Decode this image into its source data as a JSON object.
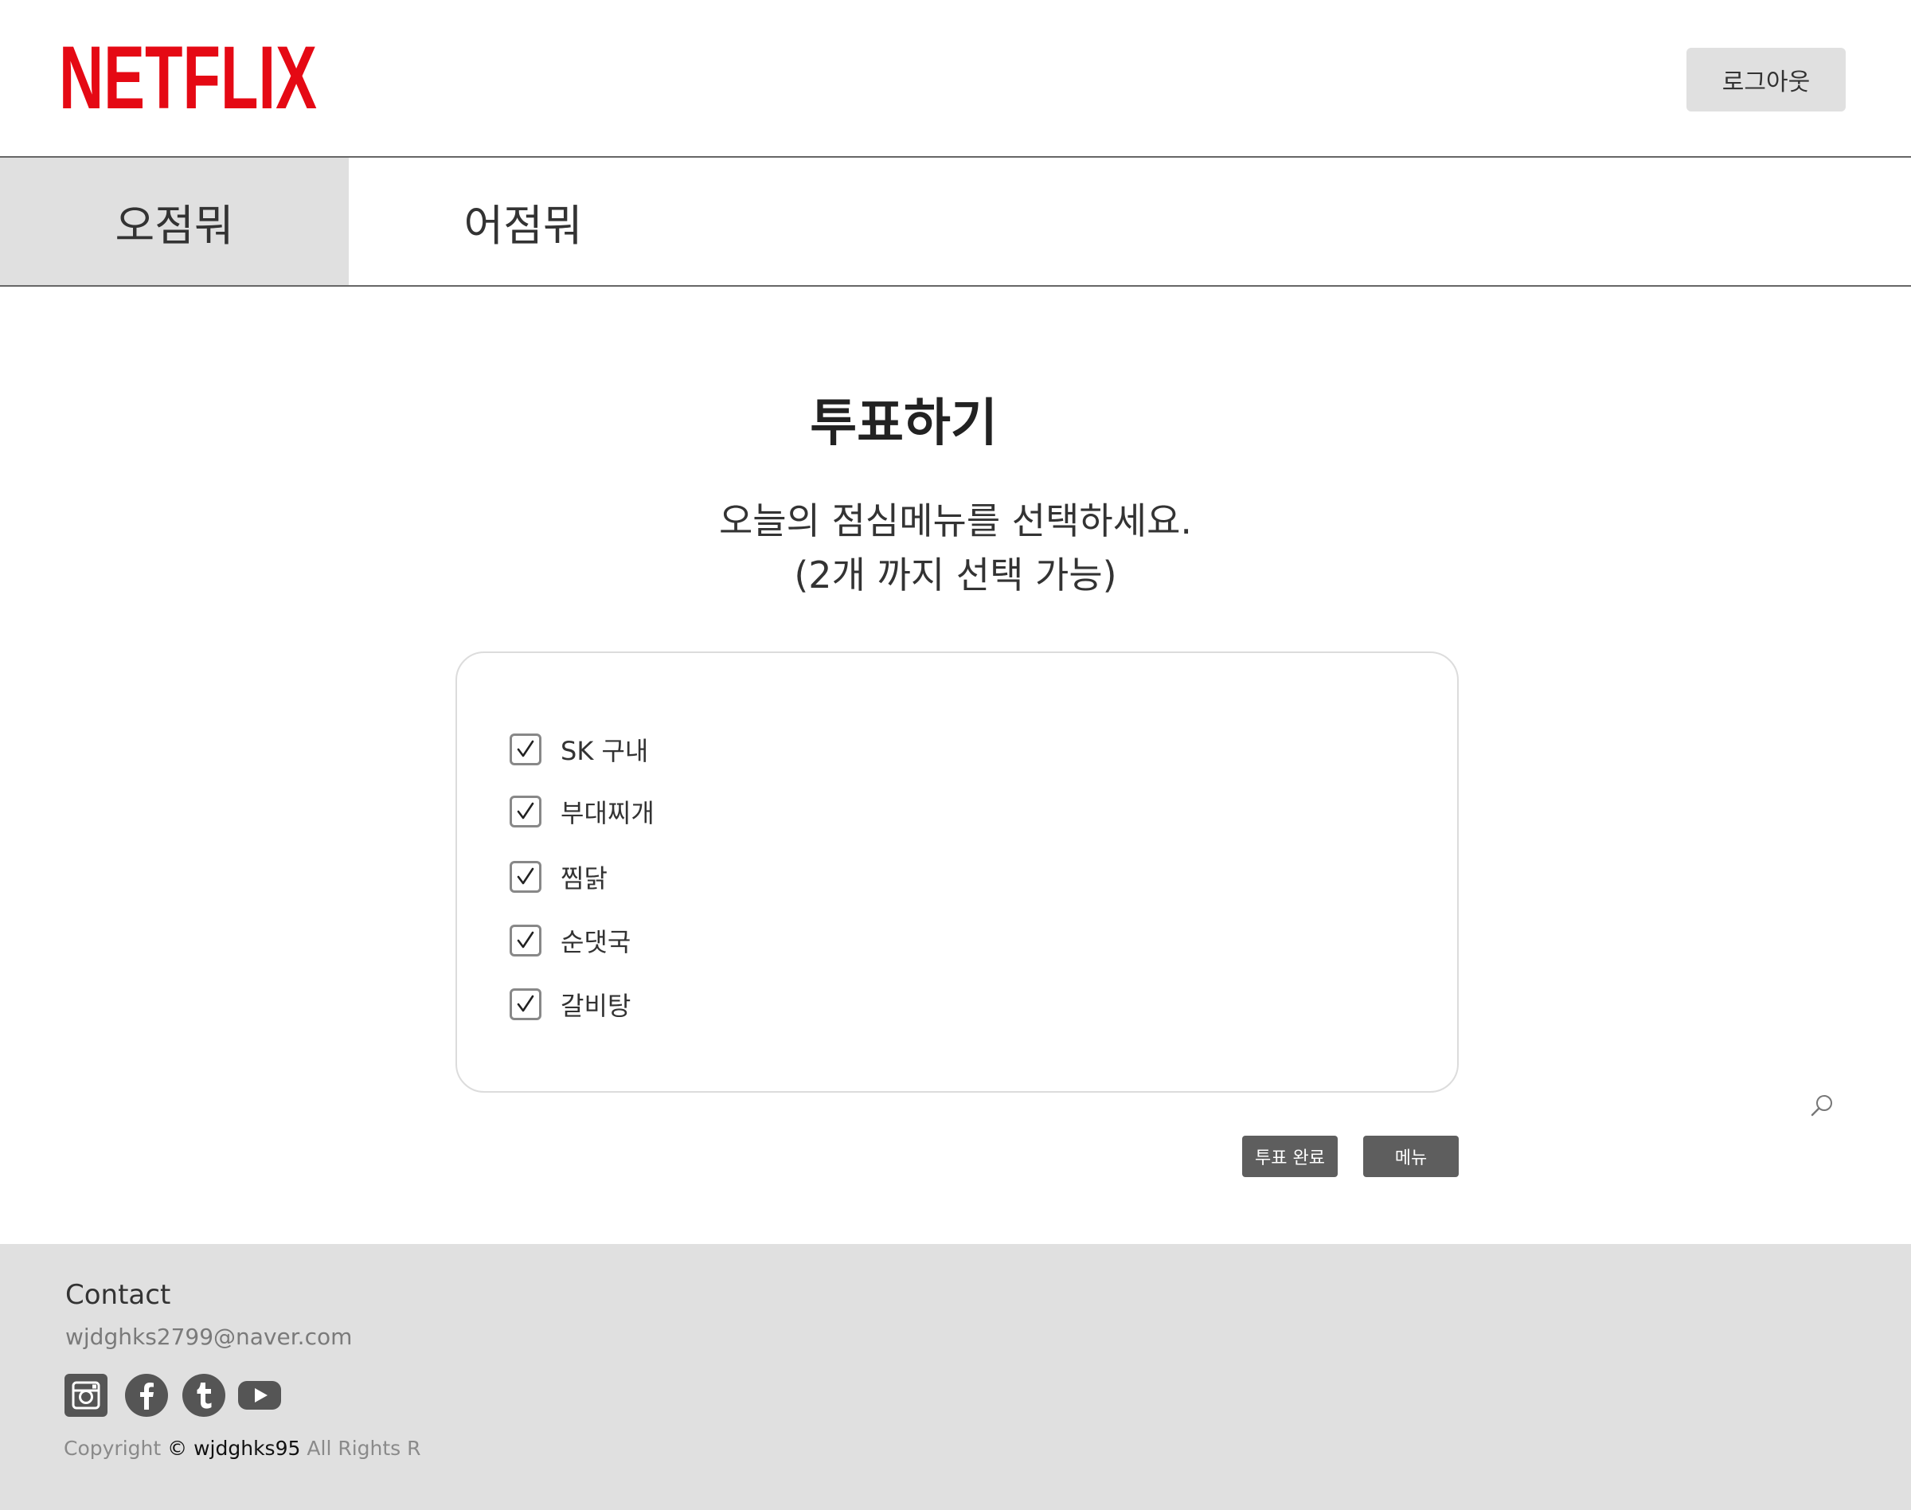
{
  "header": {
    "logo_text": "NETFLIX",
    "logout_label": "로그아웃",
    "brand_color": "#e50914"
  },
  "tabs": [
    {
      "label": "오점뭐",
      "active": true
    },
    {
      "label": "어점뭐",
      "active": false
    }
  ],
  "main": {
    "title": "투표하기",
    "subtitle_line1": "오늘의 점심메뉴를 선택하세요.",
    "subtitle_line2": "(2개 까지 선택 가능)",
    "options": [
      {
        "label": "SK 구내",
        "checked": true
      },
      {
        "label": "부대찌개",
        "checked": true
      },
      {
        "label": "찜닭",
        "checked": true
      },
      {
        "label": "순댓국",
        "checked": true
      },
      {
        "label": "갈비탕",
        "checked": true
      }
    ],
    "search_icon": "search-icon",
    "done_button": "투표 완료",
    "menu_button": "메뉴"
  },
  "footer": {
    "contact_title": "Contact",
    "contact_email": "wjdghks2799@naver.com",
    "social": [
      "instagram-icon",
      "facebook-icon",
      "tumblr-icon",
      "youtube-icon"
    ],
    "copyright_prefix": "Copyright",
    "copyright_owner": "© wjdghks95",
    "copyright_suffix": "All Rights R"
  }
}
